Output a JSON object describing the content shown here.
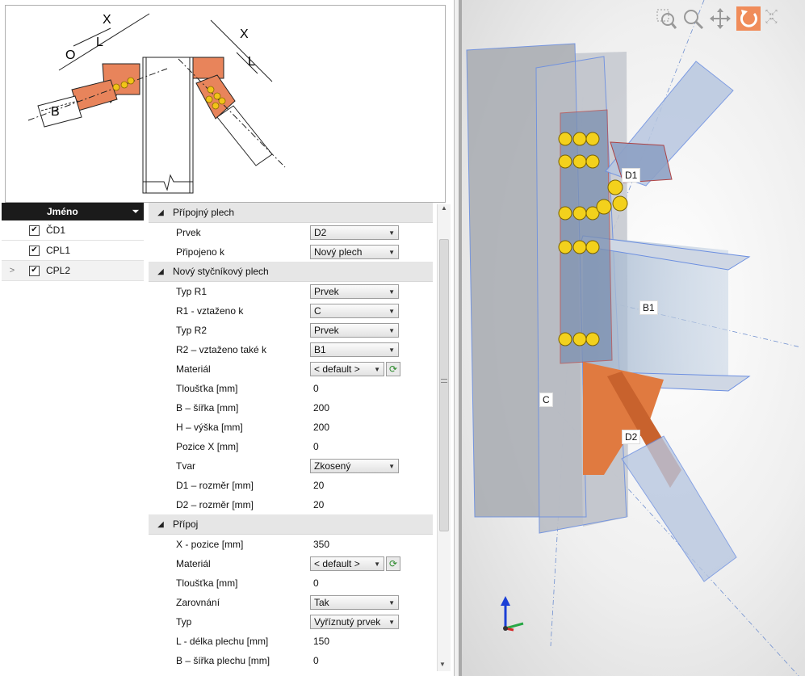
{
  "sketch": {
    "labels": {
      "x1": "X",
      "l1": "L",
      "o": "O",
      "b": "B",
      "x2": "X",
      "l2": "L"
    }
  },
  "list": {
    "header": "Jméno",
    "rows": [
      {
        "name": "ČD1",
        "checked": true,
        "selected": false
      },
      {
        "name": "CPL1",
        "checked": true,
        "selected": false
      },
      {
        "name": "CPL2",
        "checked": true,
        "selected": true
      }
    ]
  },
  "props": {
    "sections": {
      "s1": "Přípojný plech",
      "s2": "Nový styčníkový plech",
      "s3": "Přípoj"
    },
    "s1": {
      "prvek_label": "Prvek",
      "prvek_value": "D2",
      "pripojeno_label": "Připojeno k",
      "pripojeno_value": "Nový plech"
    },
    "s2": {
      "typr1_label": "Typ R1",
      "typr1_value": "Prvek",
      "r1_label": "R1 - vztaženo k",
      "r1_value": "C",
      "typr2_label": "Typ R2",
      "typr2_value": "Prvek",
      "r2_label": "R2 – vztaženo také k",
      "r2_value": "B1",
      "material_label": "Materiál",
      "material_value": "< default >",
      "tloustka_label": "Tloušťka [mm]",
      "tloustka_value": "0",
      "b_label": "B – šířka [mm]",
      "b_value": "200",
      "h_label": "H – výška [mm]",
      "h_value": "200",
      "pozicex_label": "Pozice X [mm]",
      "pozicex_value": "0",
      "tvar_label": "Tvar",
      "tvar_value": "Zkosený",
      "d1_label": "D1 – rozměr [mm]",
      "d1_value": "20",
      "d2_label": "D2 – rozměr [mm]",
      "d2_value": "20"
    },
    "s3": {
      "xpos_label": "X - pozice [mm]",
      "xpos_value": "350",
      "material_label": "Materiál",
      "material_value": "< default >",
      "tloustka_label": "Tloušťka [mm]",
      "tloustka_value": "0",
      "zarovnani_label": "Zarovnání",
      "zarovnani_value": "Tak",
      "typ_label": "Typ",
      "typ_value": "Vyříznutý prvek",
      "ldelka_label": "L - délka plechu [mm]",
      "ldelka_value": "150",
      "bsirka_label": "B – šířka plechu [mm]",
      "bsirka_value": "0"
    }
  },
  "view": {
    "labels": {
      "d1": "D1",
      "b1": "B1",
      "c": "C",
      "d2": "D2"
    },
    "toolbar": [
      "zoom-region-icon",
      "zoom-icon",
      "pan-icon",
      "rotate-icon",
      "expand-icon"
    ],
    "accent": "#f08c5a"
  }
}
